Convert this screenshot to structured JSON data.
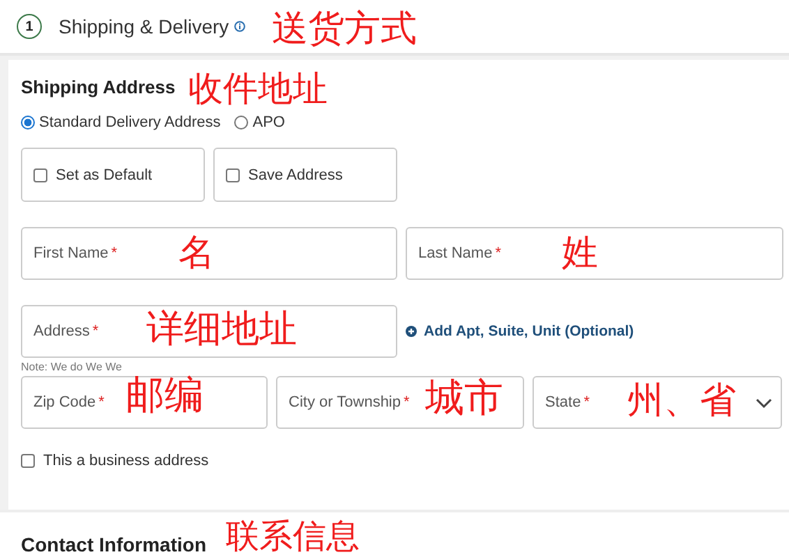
{
  "header": {
    "step": "1",
    "title": "Shipping & Delivery",
    "annotation": "送货方式"
  },
  "shipping_address": {
    "title": "Shipping Address",
    "annotation": "收件地址",
    "delivery_options": [
      {
        "label": "Standard Delivery Address",
        "selected": true
      },
      {
        "label": "APO",
        "selected": false
      }
    ],
    "options": [
      {
        "label": "Set as Default",
        "checked": false
      },
      {
        "label": "Save Address",
        "checked": false
      }
    ],
    "fields": [
      {
        "label": "First Name",
        "marker": "*",
        "annotation": "名",
        "kind": "text"
      },
      {
        "label": "Last Name",
        "marker": "*",
        "annotation": "姓",
        "kind": "text"
      },
      {
        "label": "Address",
        "marker": "*",
        "annotation": "详细地址",
        "kind": "text"
      },
      {
        "label": "Zip Code",
        "marker": "*",
        "annotation": "邮编",
        "kind": "text"
      },
      {
        "label": "City or Township",
        "marker": "*",
        "annotation": "城市",
        "kind": "text"
      },
      {
        "label": "State",
        "marker": "*",
        "annotation": "州、省",
        "kind": "select"
      }
    ],
    "add_link": "Add Apt, Suite, Unit (Optional)",
    "note": "Note: We do We We",
    "business": {
      "label": "This a business address",
      "checked": false
    }
  },
  "contact": {
    "title": "Contact Information",
    "annotation": "联系信息"
  }
}
